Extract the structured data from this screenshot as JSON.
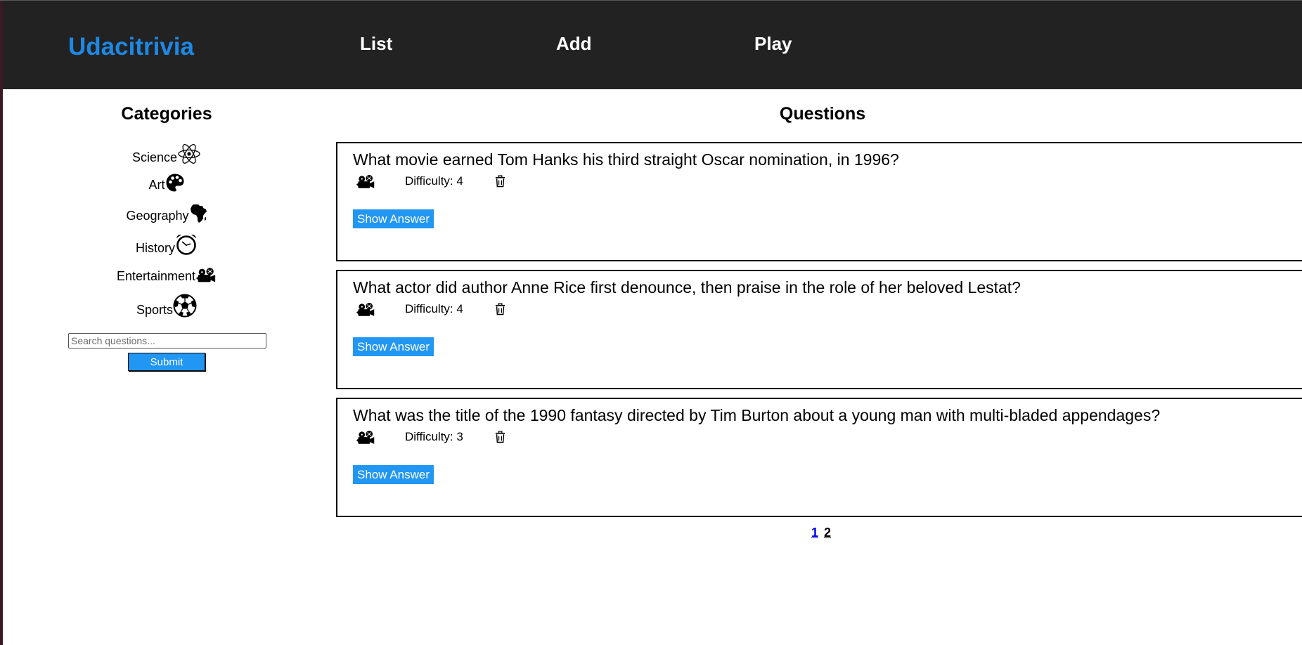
{
  "header": {
    "brand": "Udacitrivia",
    "nav": [
      "List",
      "Add",
      "Play"
    ]
  },
  "sidebar": {
    "title": "Categories",
    "categories": [
      {
        "label": "Science",
        "icon": "atom-icon"
      },
      {
        "label": "Art",
        "icon": "palette-icon"
      },
      {
        "label": "Geography",
        "icon": "africa-icon"
      },
      {
        "label": "History",
        "icon": "alarm-clock-icon"
      },
      {
        "label": "Entertainment",
        "icon": "film-camera-icon"
      },
      {
        "label": "Sports",
        "icon": "soccer-ball-icon"
      }
    ],
    "search": {
      "placeholder": "Search questions...",
      "value": ""
    },
    "submit_label": "Submit"
  },
  "main": {
    "title": "Questions",
    "questions": [
      {
        "text": "What movie earned Tom Hanks his third straight Oscar nomination, in 1996?",
        "difficulty": "Difficulty: 4",
        "show_answer": "Show Answer",
        "category_icon": "film-camera-icon"
      },
      {
        "text": "What actor did author Anne Rice first denounce, then praise in the role of her beloved Lestat?",
        "difficulty": "Difficulty: 4",
        "show_answer": "Show Answer",
        "category_icon": "film-camera-icon"
      },
      {
        "text": "What was the title of the 1990 fantasy directed by Tim Burton about a young man with multi-bladed appendages?",
        "difficulty": "Difficulty: 3",
        "show_answer": "Show Answer",
        "category_icon": "film-camera-icon"
      }
    ],
    "pages": [
      "1",
      "2"
    ],
    "current_page": "1"
  },
  "colors": {
    "header_bg": "#222222",
    "brand": "#1e88e5",
    "button": "#2196f3",
    "active_page": "#0000ee"
  }
}
